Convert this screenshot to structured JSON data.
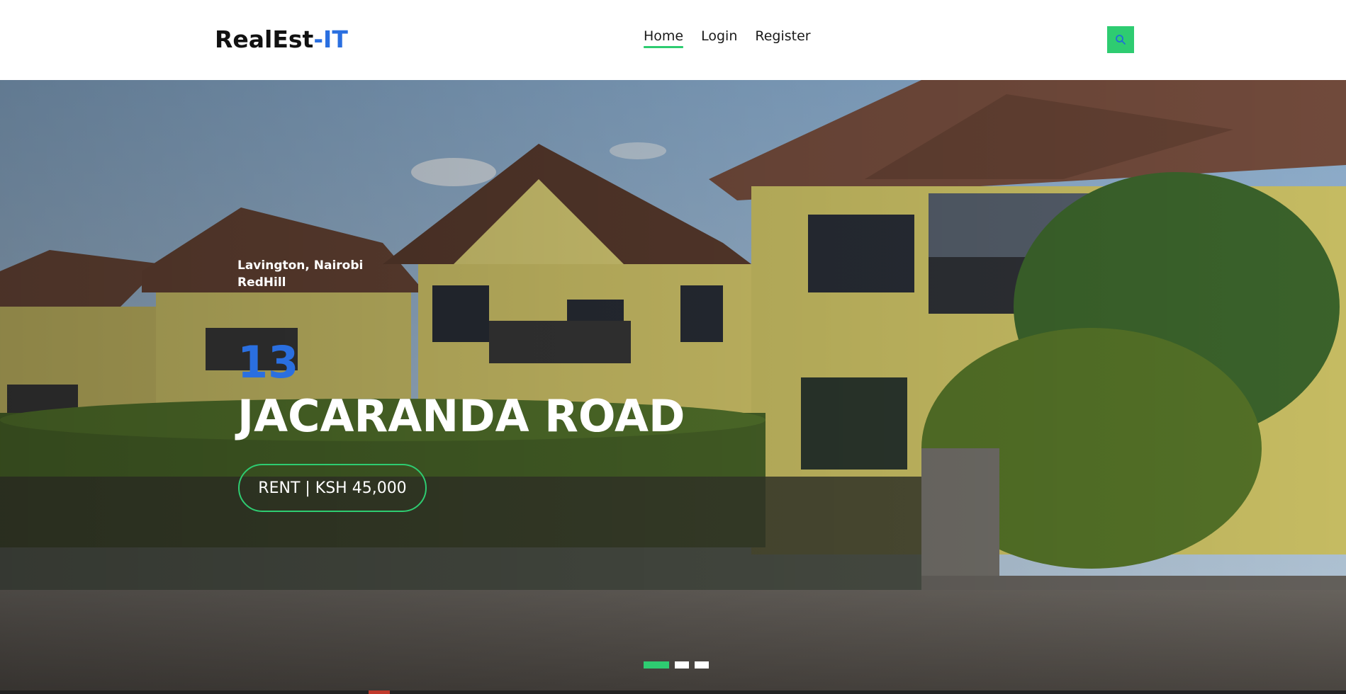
{
  "header": {
    "logo_main": "RealEst",
    "logo_accent": "-IT",
    "nav": [
      {
        "label": "Home",
        "active": true
      },
      {
        "label": "Login",
        "active": false
      },
      {
        "label": "Register",
        "active": false
      }
    ],
    "search_icon": "search-icon"
  },
  "hero": {
    "location_line1": "Lavington, Nairobi",
    "location_line2": "RedHill",
    "number": "13",
    "street": "JACARANDA ROAD",
    "price": "RENT | KSH 45,000",
    "slides": [
      {
        "active": true
      },
      {
        "active": false
      },
      {
        "active": false
      }
    ]
  },
  "colors": {
    "accent_blue": "#2a6fe0",
    "accent_green": "#2ecc71"
  }
}
